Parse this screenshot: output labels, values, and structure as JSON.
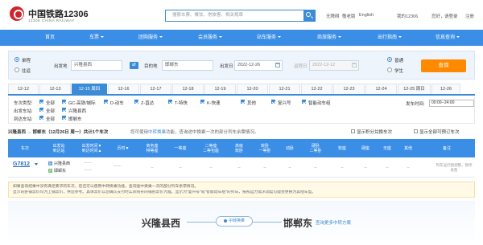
{
  "header": {
    "logo_title": "中国铁路12306",
    "logo_subtitle": "12306 CHINA RAILWAY",
    "search_placeholder": "搜索车票、餐饮、常旅客、相关规章",
    "accessibility": "无障碍",
    "care_mode": "敬老版",
    "language": "English",
    "my12306": "我的12306",
    "greeting": "您好，",
    "login": "请登录",
    "register": "注册"
  },
  "nav": {
    "items": [
      "首页",
      "车票",
      "团购服务",
      "会员服务",
      "站车服务",
      "商旅服务",
      "出行指南",
      "信息查询"
    ]
  },
  "query": {
    "trip_single": "单程",
    "trip_round": "往返",
    "from_label": "出发地",
    "from_value": "兴隆县西",
    "to_label": "目的地",
    "to_value": "邯郸东",
    "depart_label": "出发日",
    "depart_value": "2022-12-26",
    "return_label": "返程日",
    "return_value": "2022-12-12",
    "type_normal": "普通",
    "type_student": "学生",
    "query_button": "查询"
  },
  "dates": [
    "12-12",
    "12-13",
    "12-15 周四",
    "12-16",
    "12-17",
    "12-18",
    "12-19",
    "12-20",
    "12-21",
    "12-22",
    "12-23",
    "12-24",
    "12-25 周日",
    "12-26"
  ],
  "filters": {
    "train_type_label": "车次类型:",
    "all": "全部",
    "types": [
      "GC-高铁/城际",
      "D-动车",
      "Z-直达",
      "T-特快",
      "K-快速",
      "其他",
      "复兴号",
      "智能动车组"
    ],
    "from_station_label": "出发车站:",
    "from_station": "兴隆县西",
    "to_station_label": "到达车站:",
    "to_station": "邯郸东",
    "depart_time_label": "发车时间:",
    "depart_time_value": "00:00--24:00"
  },
  "summary": {
    "route": "兴隆县西 → 邯郸东（12月26日 周一）共计1个车次",
    "transfer_tip": "您可使用中转换乘功能，查询途中换乘一次的部分列车余票情况。",
    "transfer_highlight": "中转换乘",
    "show_points": "显示积分兑换车次",
    "show_all": "显示全部可预订车次"
  },
  "table": {
    "headers": [
      "车次",
      "出发站\n到达站",
      "出发时间▼\n到达时间▲",
      "历时▼",
      "商务座\n特等座",
      "一等座",
      "二等座\n二等包座",
      "高级\n软卧",
      "软卧\n一等卧",
      "动卧",
      "硬卧\n二等卧",
      "软座",
      "硬座",
      "无座",
      "其他",
      "备注"
    ],
    "rows": [
      {
        "train_no": "G7812",
        "from_badge": "始",
        "from": "兴隆县西",
        "to_badge": "终",
        "to": "邯郸东",
        "depart": "------",
        "arrive": "------",
        "duration": "------",
        "cells": [
          "--",
          "--",
          "--",
          "--",
          "--",
          "--",
          "--",
          "--",
          "--",
          "--",
          "--"
        ],
        "note": "列车运行图调整，暂停发售"
      }
    ]
  },
  "notice": {
    "text": "如果查询结果中没有满足要求的车次，您还可以使用中转换乘功能，查询途中换乘一次的部分列车余票情况。",
    "text2": "显示的卧铺票价均为上铺票价，供您参考。具体票价以您确认支付时实际购买的铺别票价为准。显示为\"复兴号\"或\"智能动车组\"的列车，按照运力需求调度可能会更换为其他车型。"
  },
  "banner": {
    "from_city": "兴隆县西",
    "pill": "中转换乘",
    "to_city": "邯郸东",
    "link": "查询更多中转方案"
  },
  "colors": {
    "brand_red": "#d0252c",
    "nav_blue": "#3a8ee6",
    "query_orange": "#ff8a00",
    "link_blue": "#2a6fc1"
  }
}
